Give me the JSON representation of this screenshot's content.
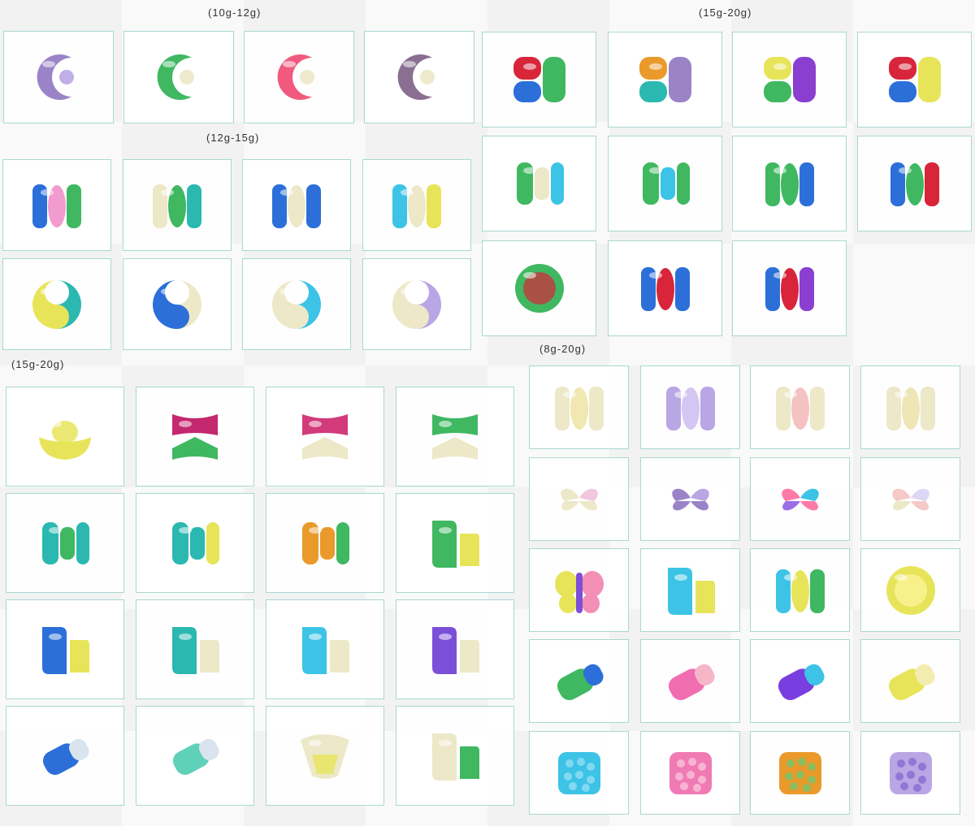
{
  "sections": {
    "s1": {
      "label": "(10g-12g)"
    },
    "s2": {
      "label": "(12g-15g)"
    },
    "s3": {
      "label": "(15g-20g)"
    },
    "s4": {
      "label": "(15g-20g)"
    },
    "s5": {
      "label": "(8g-20g)"
    }
  },
  "icons": [
    "moon-pod-icon",
    "tri-chamber-pod-icon",
    "bar-pod-icon",
    "swirl-pod-icon",
    "ingot-pod-icon",
    "chevron-pod-icon",
    "ring-pod-icon",
    "l-shape-pod-icon",
    "wedge-pod-icon",
    "heart-flower-pod-icon",
    "butterfly-pod-icon",
    "round-bead-pod-icon",
    "tilted-pod-icon",
    "square-bead-pod-icon"
  ],
  "colors": {
    "purple": "#9b83c8",
    "green": "#3fb861",
    "pink": "#f05a7e",
    "mauve": "#8a6f92",
    "red": "#d8253a",
    "blue": "#2c6fd9",
    "teal": "#2bb8b0",
    "yellow": "#e7e45a",
    "cyan": "#3cc3e6",
    "ivory": "#ece8c8",
    "lavender": "#b9a6e4",
    "orange": "#e99a2a"
  }
}
